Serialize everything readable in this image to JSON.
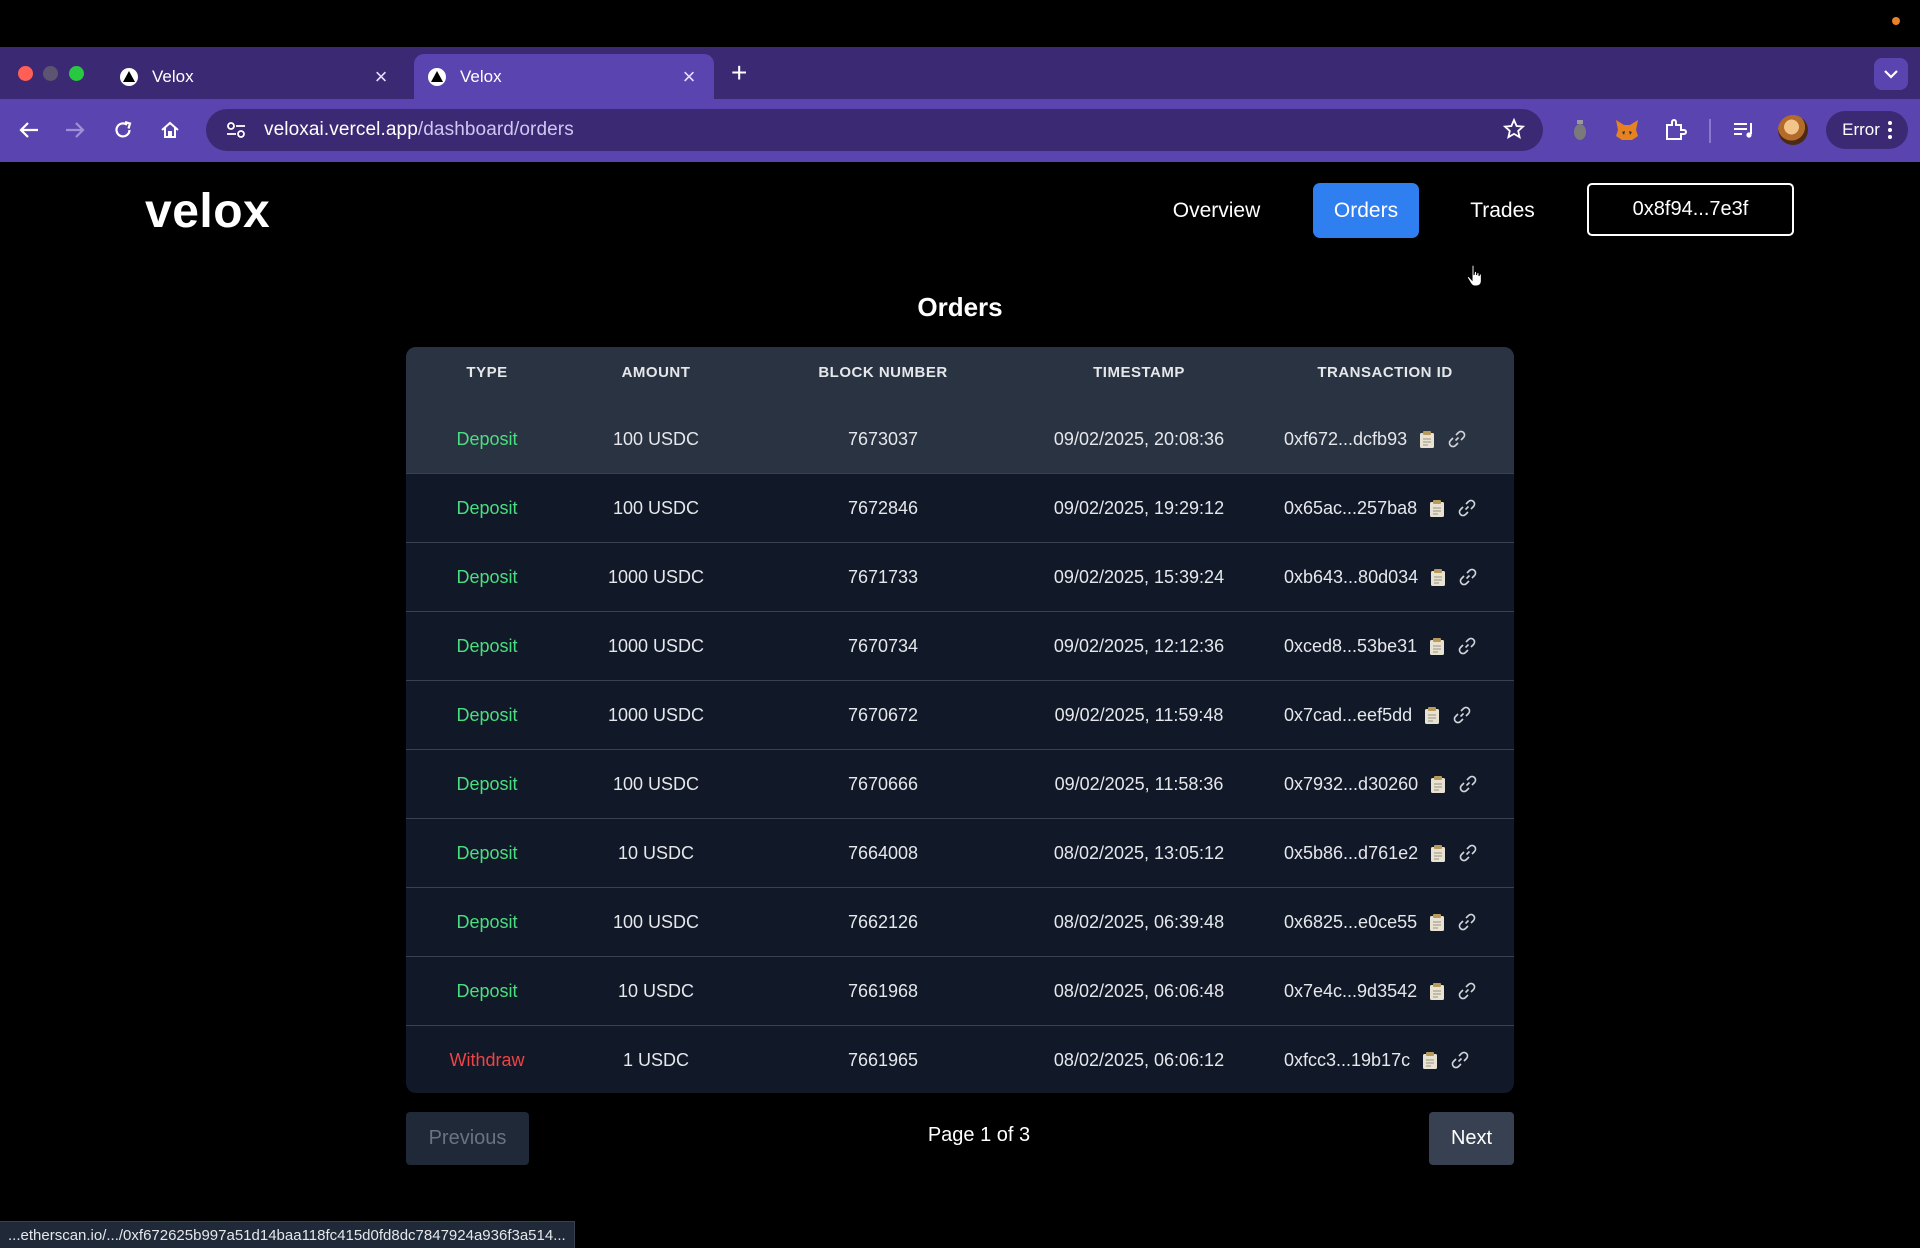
{
  "browser": {
    "tabs": [
      {
        "title": "Velox"
      },
      {
        "title": "Velox"
      }
    ],
    "url_host": "veloxai.vercel.app",
    "url_path": "/dashboard/orders",
    "profile_button": "Error"
  },
  "header": {
    "logo": "velox",
    "nav": {
      "overview": "Overview",
      "orders": "Orders",
      "trades": "Trades"
    },
    "wallet": "0x8f94...7e3f"
  },
  "orders": {
    "title": "Orders",
    "columns": [
      "TYPE",
      "AMOUNT",
      "BLOCK NUMBER",
      "TIMESTAMP",
      "TRANSACTION ID"
    ],
    "rows": [
      {
        "type": "Deposit",
        "amount": "100 USDC",
        "block": "7673037",
        "timestamp": "09/02/2025, 20:08:36",
        "tx": "0xf672...dcfb93"
      },
      {
        "type": "Deposit",
        "amount": "100 USDC",
        "block": "7672846",
        "timestamp": "09/02/2025, 19:29:12",
        "tx": "0x65ac...257ba8"
      },
      {
        "type": "Deposit",
        "amount": "1000 USDC",
        "block": "7671733",
        "timestamp": "09/02/2025, 15:39:24",
        "tx": "0xb643...80d034"
      },
      {
        "type": "Deposit",
        "amount": "1000 USDC",
        "block": "7670734",
        "timestamp": "09/02/2025, 12:12:36",
        "tx": "0xced8...53be31"
      },
      {
        "type": "Deposit",
        "amount": "1000 USDC",
        "block": "7670672",
        "timestamp": "09/02/2025, 11:59:48",
        "tx": "0x7cad...eef5dd"
      },
      {
        "type": "Deposit",
        "amount": "100 USDC",
        "block": "7670666",
        "timestamp": "09/02/2025, 11:58:36",
        "tx": "0x7932...d30260"
      },
      {
        "type": "Deposit",
        "amount": "10 USDC",
        "block": "7664008",
        "timestamp": "08/02/2025, 13:05:12",
        "tx": "0x5b86...d761e2"
      },
      {
        "type": "Deposit",
        "amount": "100 USDC",
        "block": "7662126",
        "timestamp": "08/02/2025, 06:39:48",
        "tx": "0x6825...e0ce55"
      },
      {
        "type": "Deposit",
        "amount": "10 USDC",
        "block": "7661968",
        "timestamp": "08/02/2025, 06:06:48",
        "tx": "0x7e4c...9d3542"
      },
      {
        "type": "Withdraw",
        "amount": "1 USDC",
        "block": "7661965",
        "timestamp": "08/02/2025, 06:06:12",
        "tx": "0xfcc3...19b17c"
      }
    ]
  },
  "pagination": {
    "previous": "Previous",
    "info": "Page 1 of 3",
    "next": "Next"
  },
  "status_bar": "...etherscan.io/.../0xf672625b997a51d14baa118fc415d0fd8dc7847924a936f3a514...",
  "colors": {
    "deposit": "#4ade80",
    "withdraw": "#ef4444",
    "accent": "#2f7ff0",
    "browser_frame": "#5a45b0"
  }
}
